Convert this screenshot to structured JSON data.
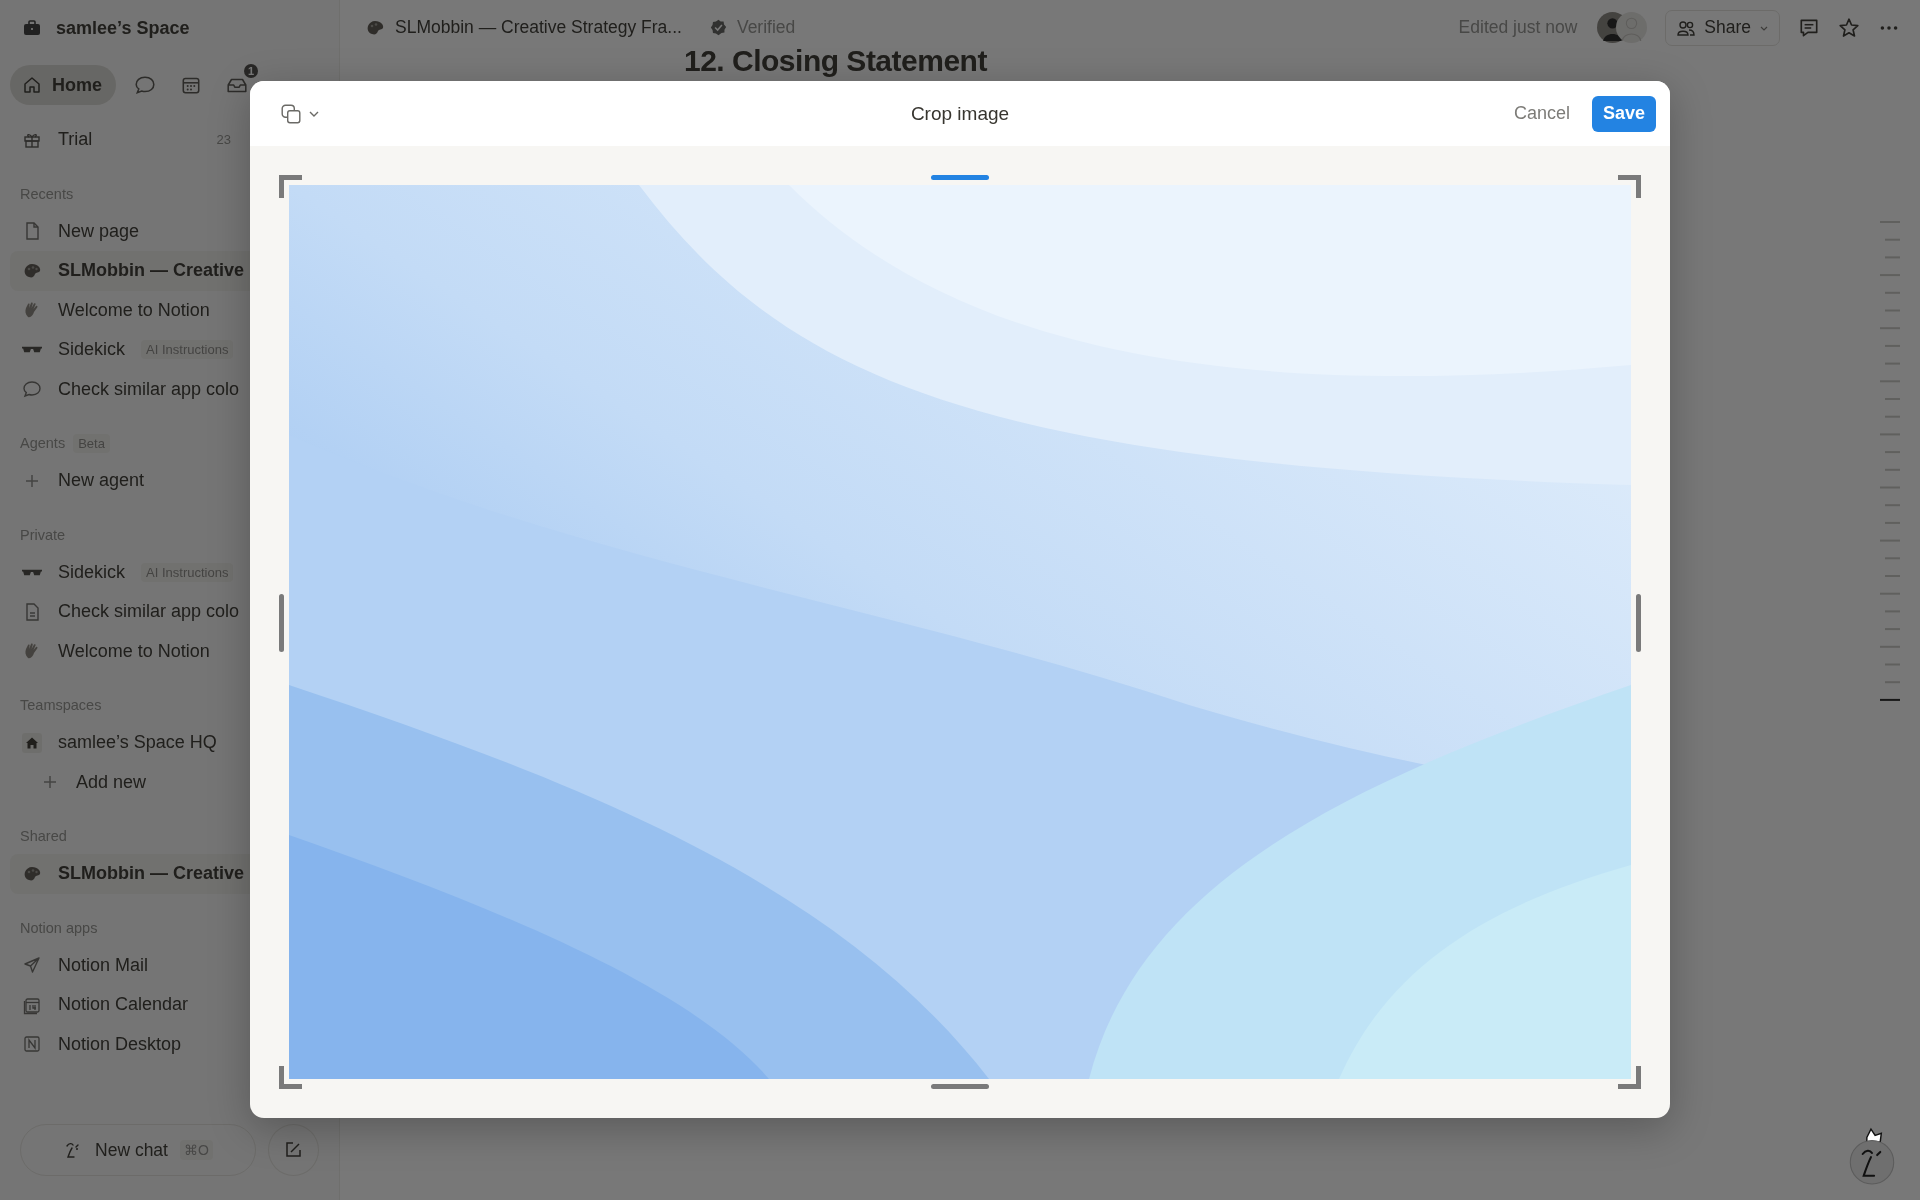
{
  "workspace": {
    "name": "samlee’s Space"
  },
  "nav": [
    {
      "kind": "home",
      "label": "Home",
      "selected": true
    },
    {
      "kind": "chat"
    },
    {
      "kind": "calendar"
    },
    {
      "kind": "inbox",
      "badge": "1"
    }
  ],
  "trial": {
    "label": "Trial",
    "count": "23"
  },
  "sections": [
    {
      "title": "Recents",
      "items": [
        {
          "kind": "page",
          "label": "New page",
          "selected": false
        },
        {
          "kind": "palette",
          "label": "SLMobbin — Creative",
          "selected": true
        },
        {
          "kind": "wave",
          "label": "Welcome to Notion",
          "selected": false
        },
        {
          "kind": "glasses",
          "label": "Sidekick",
          "tag": "AI Instructions",
          "selected": false
        },
        {
          "kind": "chat",
          "label": "Check similar app colo",
          "selected": false
        }
      ]
    },
    {
      "title": "Agents",
      "badge": "Beta",
      "items": [
        {
          "kind": "plus",
          "label": "New agent",
          "selected": false
        }
      ]
    },
    {
      "title": "Private",
      "items": [
        {
          "kind": "glasses",
          "label": "Sidekick",
          "tag": "AI Instructions",
          "selected": false
        },
        {
          "kind": "doc",
          "label": "Check similar app colo",
          "selected": false
        },
        {
          "kind": "wave",
          "label": "Welcome to Notion",
          "selected": false
        }
      ]
    },
    {
      "title": "Teamspaces",
      "items": [
        {
          "kind": "house",
          "label": "samlee’s Space HQ",
          "selected": false
        },
        {
          "kind": "add",
          "label": "Add new",
          "selected": false
        }
      ]
    },
    {
      "title": "Shared",
      "items": [
        {
          "kind": "palette",
          "label": "SLMobbin — Creative",
          "selected": true
        }
      ]
    },
    {
      "title": "Notion apps",
      "items": [
        {
          "kind": "send",
          "label": "Notion Mail",
          "selected": false
        },
        {
          "kind": "calendar",
          "label": "Notion Calendar",
          "selected": false
        },
        {
          "kind": "app",
          "label": "Notion Desktop",
          "selected": false
        }
      ]
    }
  ],
  "new_chat": {
    "label": "New chat",
    "shortcut": "⌘O"
  },
  "breadcrumb": {
    "title": "SLMobbin — Creative Strategy Fra...",
    "verified": "Verified"
  },
  "edited": "Edited just now",
  "share": "Share",
  "page_title": "12. Closing Statement",
  "dialog": {
    "title": "Crop image",
    "cancel": "Cancel",
    "save": "Save"
  }
}
